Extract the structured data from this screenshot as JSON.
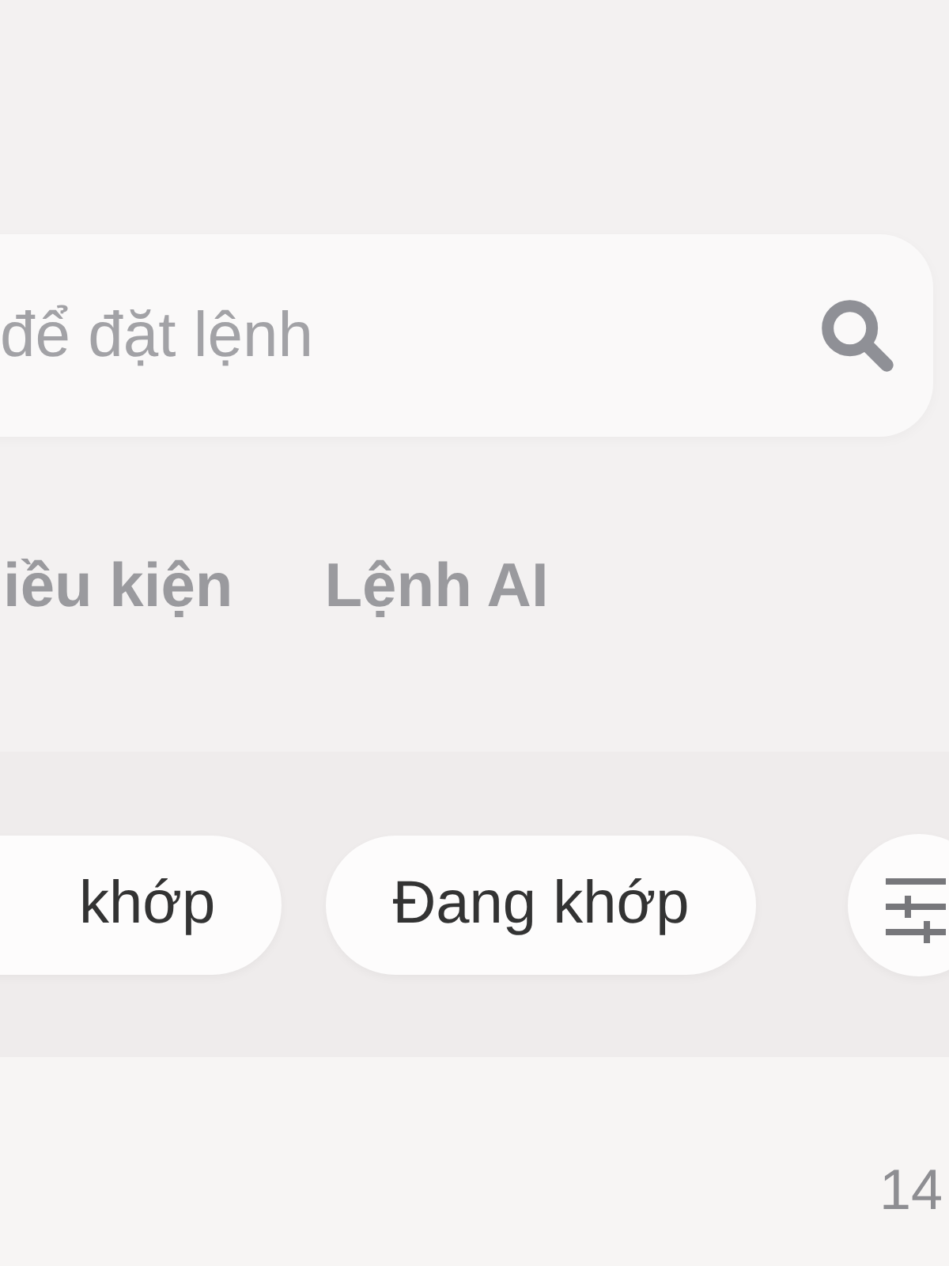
{
  "search": {
    "placeholder": "để đặt lệnh"
  },
  "tabs": [
    {
      "label": "iều kiện",
      "selected": false
    },
    {
      "label": "Lệnh AI",
      "selected": false
    }
  ],
  "filters": [
    {
      "label": "khớp",
      "selected": false
    },
    {
      "label": "Đang khớp",
      "selected": false
    }
  ],
  "row": {
    "value": "14"
  }
}
